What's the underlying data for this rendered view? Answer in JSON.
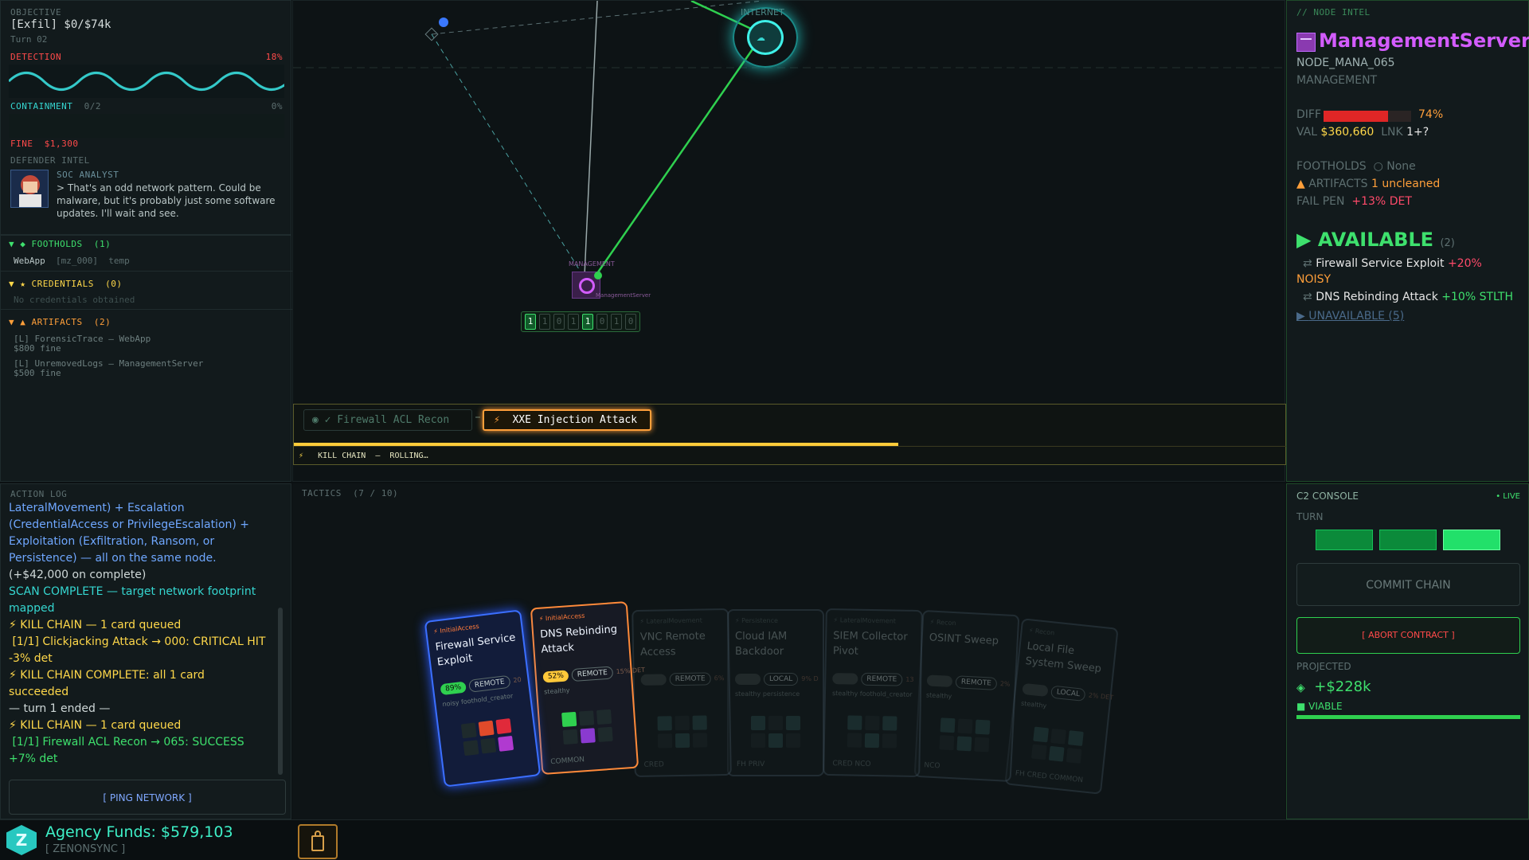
{
  "objective": {
    "label": "OBJECTIVE",
    "goal": "[Exfil] $0/$74k",
    "turn": "Turn 02",
    "detection_label": "DETECTION",
    "detection_pct": "18%",
    "detection_value": 0.18,
    "containment_label": "CONTAINMENT",
    "containment_count": "0/2",
    "containment_pct": "0%",
    "fine_label": "FINE",
    "fine_value": "$1,300"
  },
  "defender": {
    "label": "DEFENDER INTEL",
    "role": "SOC ANALYST",
    "quote": "> That's an odd network pattern. Could be malware, but it's probably just some software updates. I'll wait and see."
  },
  "footholds": {
    "header": "FOOTHOLDS",
    "count": "(1)",
    "item_name": "WebApp",
    "item_id": "[mz_000]",
    "item_tag": "temp"
  },
  "credentials": {
    "header": "CREDENTIALS",
    "count": "(0)",
    "empty": "No credentials obtained"
  },
  "artifacts": {
    "header": "ARTIFACTS",
    "count": "(2)",
    "items": [
      {
        "name": "[L] ForensicTrace — WebApp",
        "fine": "$800 fine"
      },
      {
        "name": "[L] UnremovedLogs — ManagementServer",
        "fine": "$500 fine"
      }
    ]
  },
  "action_log": {
    "label": "ACTION LOG",
    "lines": [
      {
        "text": "LateralMovement) + Escalation",
        "color": "#6fa7ff"
      },
      {
        "text": "(CredentialAccess or PrivilegeEscalation) +",
        "color": "#6fa7ff"
      },
      {
        "text": "Exploitation (Exfiltration, Ransom, or",
        "color": "#6fa7ff"
      },
      {
        "text": "Persistence) — all on the same node.",
        "color": "#6fa7ff"
      },
      {
        "text": "(+$42,000 on complete)",
        "color": "#cfd8d8"
      },
      {
        "text": "SCAN COMPLETE — target network footprint",
        "color": "#35d6d0"
      },
      {
        "text": "mapped",
        "color": "#35d6d0"
      },
      {
        "text": "⚡ KILL CHAIN — 1 card queued",
        "color": "#ffd84a"
      },
      {
        "text": " [1/1] Clickjacking Attack → 000: CRITICAL HIT",
        "color": "#ffd84a"
      },
      {
        "text": "-3% det",
        "color": "#ffd84a"
      },
      {
        "text": "⚡ KILL CHAIN COMPLETE: all 1 card",
        "color": "#ffd84a"
      },
      {
        "text": "succeeded",
        "color": "#ffd84a"
      },
      {
        "text": "— turn 1 ended —",
        "color": "#cfd8d8"
      },
      {
        "text": "⚡ KILL CHAIN — 1 card queued",
        "color": "#ffd84a"
      },
      {
        "text": " [1/1] Firewall ACL Recon → 065: SUCCESS",
        "color": "#3ee06d"
      },
      {
        "text": "+7% det",
        "color": "#3ee06d"
      }
    ],
    "ping_button": "[ PING NETWORK ]"
  },
  "map": {
    "internet_label": "INTERNET",
    "mgmt_label": "MANAGEMENT",
    "mgmt_sub": "ManagementServer",
    "bits": [
      "1",
      "1",
      "0",
      "1",
      "1",
      "0",
      "1",
      "0"
    ],
    "bits_active": [
      true,
      false,
      false,
      false,
      true,
      false,
      false,
      false
    ],
    "queue": {
      "done_item": "✓ Firewall ACL Recon",
      "active_item": "XXE Injection Attack",
      "status_label": "KILL CHAIN",
      "status_text": "ROLLING…",
      "progress": 0.75
    }
  },
  "tactics": {
    "label": "TACTICS",
    "count": "(7 / 10)",
    "cards": [
      {
        "category": "InitialAccess",
        "title": "Firewall Service Exploit",
        "chance": "89%",
        "mode": "REMOTE",
        "det": "20",
        "tags": "noisy  foothold_creator",
        "foot": "",
        "accent": "#3b6fff"
      },
      {
        "category": "InitialAccess",
        "title": "DNS Rebinding Attack",
        "chance": "52%",
        "mode": "REMOTE",
        "det": "15% DET",
        "tags": "stealthy",
        "foot": "COMMON",
        "accent": "#ff8a3a"
      },
      {
        "category": "LateralMovement",
        "title": "VNC Remote Access",
        "chance": "",
        "mode": "REMOTE",
        "det": "6%",
        "tags": "",
        "foot": "CRED",
        "accent": "#3a4a55"
      },
      {
        "category": "Persistence",
        "title": "Cloud IAM Backdoor",
        "chance": "",
        "mode": "LOCAL",
        "det": "9% D",
        "tags": "stealthy  persistence",
        "foot": "FH  PRIV",
        "accent": "#3a4a55"
      },
      {
        "category": "LateralMovement",
        "title": "SIEM Collector Pivot",
        "chance": "",
        "mode": "REMOTE",
        "det": "13",
        "tags": "stealthy  foothold_creator",
        "foot": "CRED  NCO",
        "accent": "#3a4a55"
      },
      {
        "category": "Recon",
        "title": "OSINT Sweep",
        "chance": "",
        "mode": "REMOTE",
        "det": "2%",
        "tags": "stealthy",
        "foot": "NCO",
        "accent": "#3a4a55"
      },
      {
        "category": "Recon",
        "title": "Local File System Sweep",
        "chance": "",
        "mode": "LOCAL",
        "det": "2% DET",
        "tags": "stealthy",
        "foot": "FH  CRED  COMMON",
        "accent": "#3a4a55"
      }
    ]
  },
  "node_intel": {
    "label": "// NODE INTEL",
    "name": "ManagementServer",
    "id": "NODE_MANA_065",
    "type": "MANAGEMENT",
    "diff_label": "DIFF",
    "diff_pct": "74%",
    "diff_value": 0.74,
    "val_label": "VAL",
    "val": "$360,660",
    "lnk_label": "LNK",
    "lnk": "1+?",
    "footholds_label": "FOOTHOLDS",
    "footholds_value": "None",
    "artifacts_label": "ARTIFACTS",
    "artifacts_value": "1 uncleaned",
    "failpen_label": "FAIL PEN",
    "failpen_value": "+13% DET",
    "available_label": "AVAILABLE",
    "available_count": "(2)",
    "avail_items": [
      {
        "name": "Firewall Service Exploit",
        "bonus": "+20%",
        "note": "NOISY"
      },
      {
        "name": "DNS Rebinding Attack",
        "bonus": "+10% STLTH",
        "note": ""
      }
    ],
    "unavailable": "UNAVAILABLE (5)"
  },
  "c2": {
    "label": "C2 CONSOLE",
    "live": "• LIVE",
    "turn_label": "TURN",
    "commit": "COMMIT CHAIN",
    "abort": "[ ABORT CONTRACT ]",
    "projected_label": "PROJECTED",
    "projected_value": "+$228k",
    "viable": "VIABLE"
  },
  "footer": {
    "funds": "Agency Funds: $579,103",
    "agency": "[ ZENONSYNC ]"
  },
  "colors": {
    "accent_green": "#3ee06d",
    "magenta": "#d35cff",
    "danger": "#ff4a4a",
    "warning": "#ffd84a"
  }
}
